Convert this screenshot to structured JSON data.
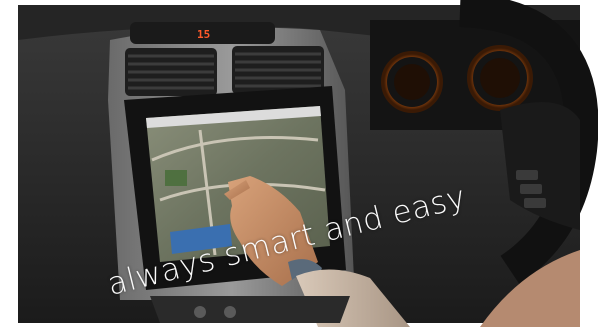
{
  "scene": {
    "subject": "tablet-in-car-dashboard",
    "caption": "always smart and easy",
    "display_digits": "15",
    "colors": {
      "cabin": "#2b2b2b",
      "gauge_glow": "#ff8a2a",
      "caption": "#fafafa",
      "tablet_frame": "#141414"
    }
  }
}
